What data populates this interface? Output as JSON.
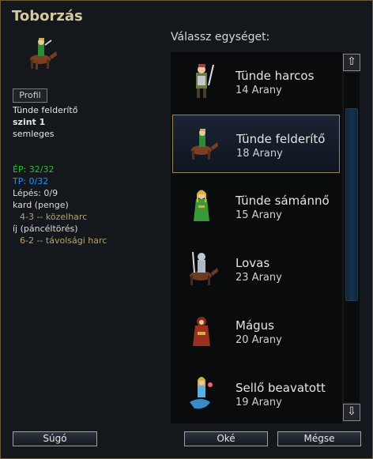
{
  "dialog": {
    "title": "Toborzás"
  },
  "detail": {
    "profile_label": "Profil",
    "unit_name": "Tünde felderítő",
    "level": "szint 1",
    "alignment": "semleges",
    "hp": "ÉP: 32/32",
    "xp": "TP: 0/32",
    "moves": "Lépés: 0/9",
    "attacks": [
      {
        "name": "kard (penge)",
        "detail": "4-3 -- közelharc"
      },
      {
        "name": "íj (páncéltörés)",
        "detail": "6-2 -- távolsági harc"
      }
    ]
  },
  "list": {
    "caption": "Válassz egységet:",
    "units": [
      {
        "name": "Tünde harcos",
        "cost": "14 Arany",
        "icon": "elf-fighter-icon"
      },
      {
        "name": "Tünde felderítő",
        "cost": "18 Arany",
        "icon": "elf-scout-icon"
      },
      {
        "name": "Tünde sámánnő",
        "cost": "15 Arany",
        "icon": "elf-shaman-icon"
      },
      {
        "name": "Lovas",
        "cost": "23 Arany",
        "icon": "cavalryman-icon"
      },
      {
        "name": "Mágus",
        "cost": "20 Arany",
        "icon": "mage-icon"
      },
      {
        "name": "Sellő beavatott",
        "cost": "19 Arany",
        "icon": "merfolk-initiate-icon"
      }
    ],
    "selected_index": 1
  },
  "scrollbar": {
    "up_glyph": "⇧",
    "down_glyph": "⇩"
  },
  "buttons": {
    "help": "Súgó",
    "ok": "Oké",
    "cancel": "Mégse"
  },
  "colors": {
    "title": "#d6c9a0",
    "hp": "#22c322",
    "xp": "#1e90ff",
    "selection_border": "#9a8650"
  }
}
